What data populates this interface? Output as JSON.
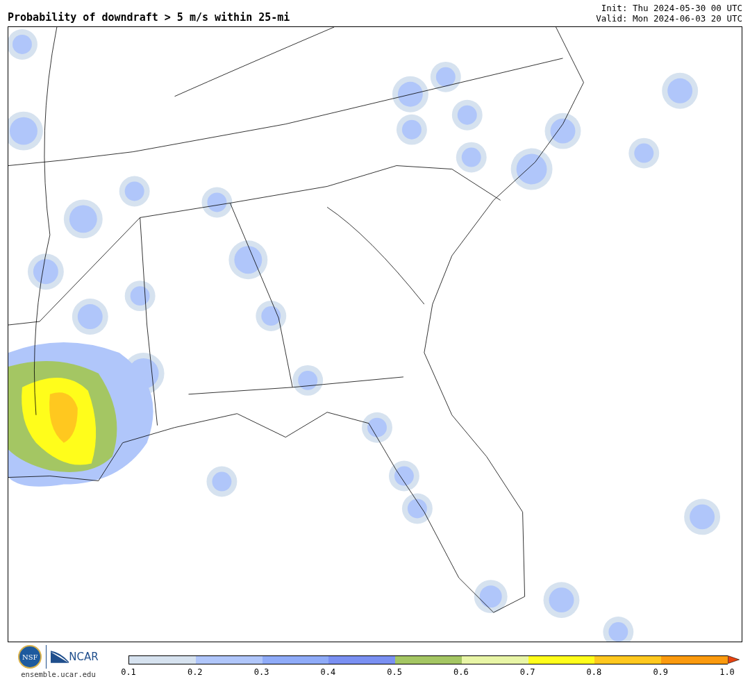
{
  "title": "Probability of downdraft > 5 m/s within 25-mi",
  "init": "Init: Thu 2024-05-30 00 UTC",
  "valid": "Valid: Mon 2024-06-03 20 UTC",
  "logos": {
    "nsf": "NSF",
    "ncar": "NCAR",
    "url": "ensemble.ucar.edu"
  },
  "colorbar": {
    "segments": [
      {
        "kind": "band",
        "color": "#d6e2ef"
      },
      {
        "kind": "band",
        "color": "#b0c6fa"
      },
      {
        "kind": "band",
        "color": "#8fabf8"
      },
      {
        "kind": "band",
        "color": "#7a90f2"
      },
      {
        "kind": "band",
        "color": "#a4c663"
      },
      {
        "kind": "band",
        "color": "#e8f5a6"
      },
      {
        "kind": "band",
        "color": "#fffd1b"
      },
      {
        "kind": "band",
        "color": "#ffc81f"
      },
      {
        "kind": "band",
        "color": "#fb9a0e"
      },
      {
        "kind": "arrow",
        "color": "#e8430f"
      }
    ],
    "ticks": [
      "0.1",
      "0.2",
      "0.3",
      "0.4",
      "0.5",
      "0.6",
      "0.7",
      "0.8",
      "0.9",
      "1.0"
    ]
  }
}
